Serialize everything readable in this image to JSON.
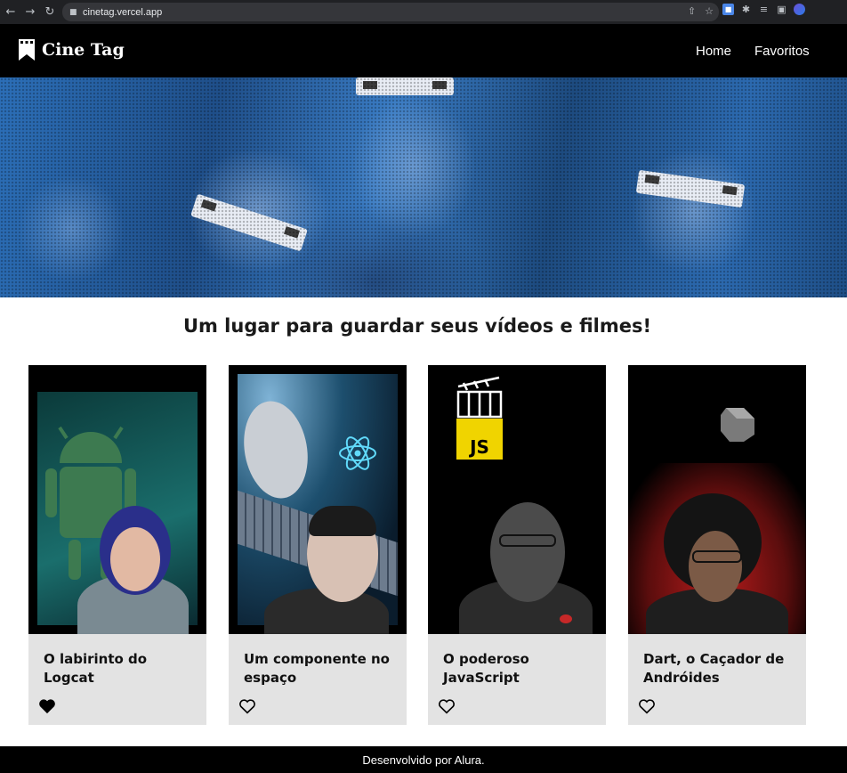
{
  "browser": {
    "url": "cinetag.vercel.app"
  },
  "header": {
    "logo_text": "Cine Tag",
    "nav": [
      {
        "label": "Home"
      },
      {
        "label": "Favoritos"
      }
    ]
  },
  "main": {
    "tagline": "Um lugar para guardar seus vídeos e filmes!",
    "cards": [
      {
        "title": "O labirinto do Logcat",
        "favorited": true,
        "thumb_badge": ""
      },
      {
        "title": "Um componente no espaço",
        "favorited": false,
        "thumb_badge": ""
      },
      {
        "title": "O poderoso JavaScript",
        "favorited": false,
        "thumb_badge": "JS"
      },
      {
        "title": "Dart, o Caçador de Andróides",
        "favorited": false,
        "thumb_badge": ""
      }
    ]
  },
  "footer": {
    "text": "Desenvolvido por Alura."
  },
  "colors": {
    "header_bg": "#000000",
    "banner_blue": "#2c6fb8",
    "card_bg": "#e3e3e3",
    "js_yellow": "#f0d400",
    "footer_bg": "#000000"
  }
}
